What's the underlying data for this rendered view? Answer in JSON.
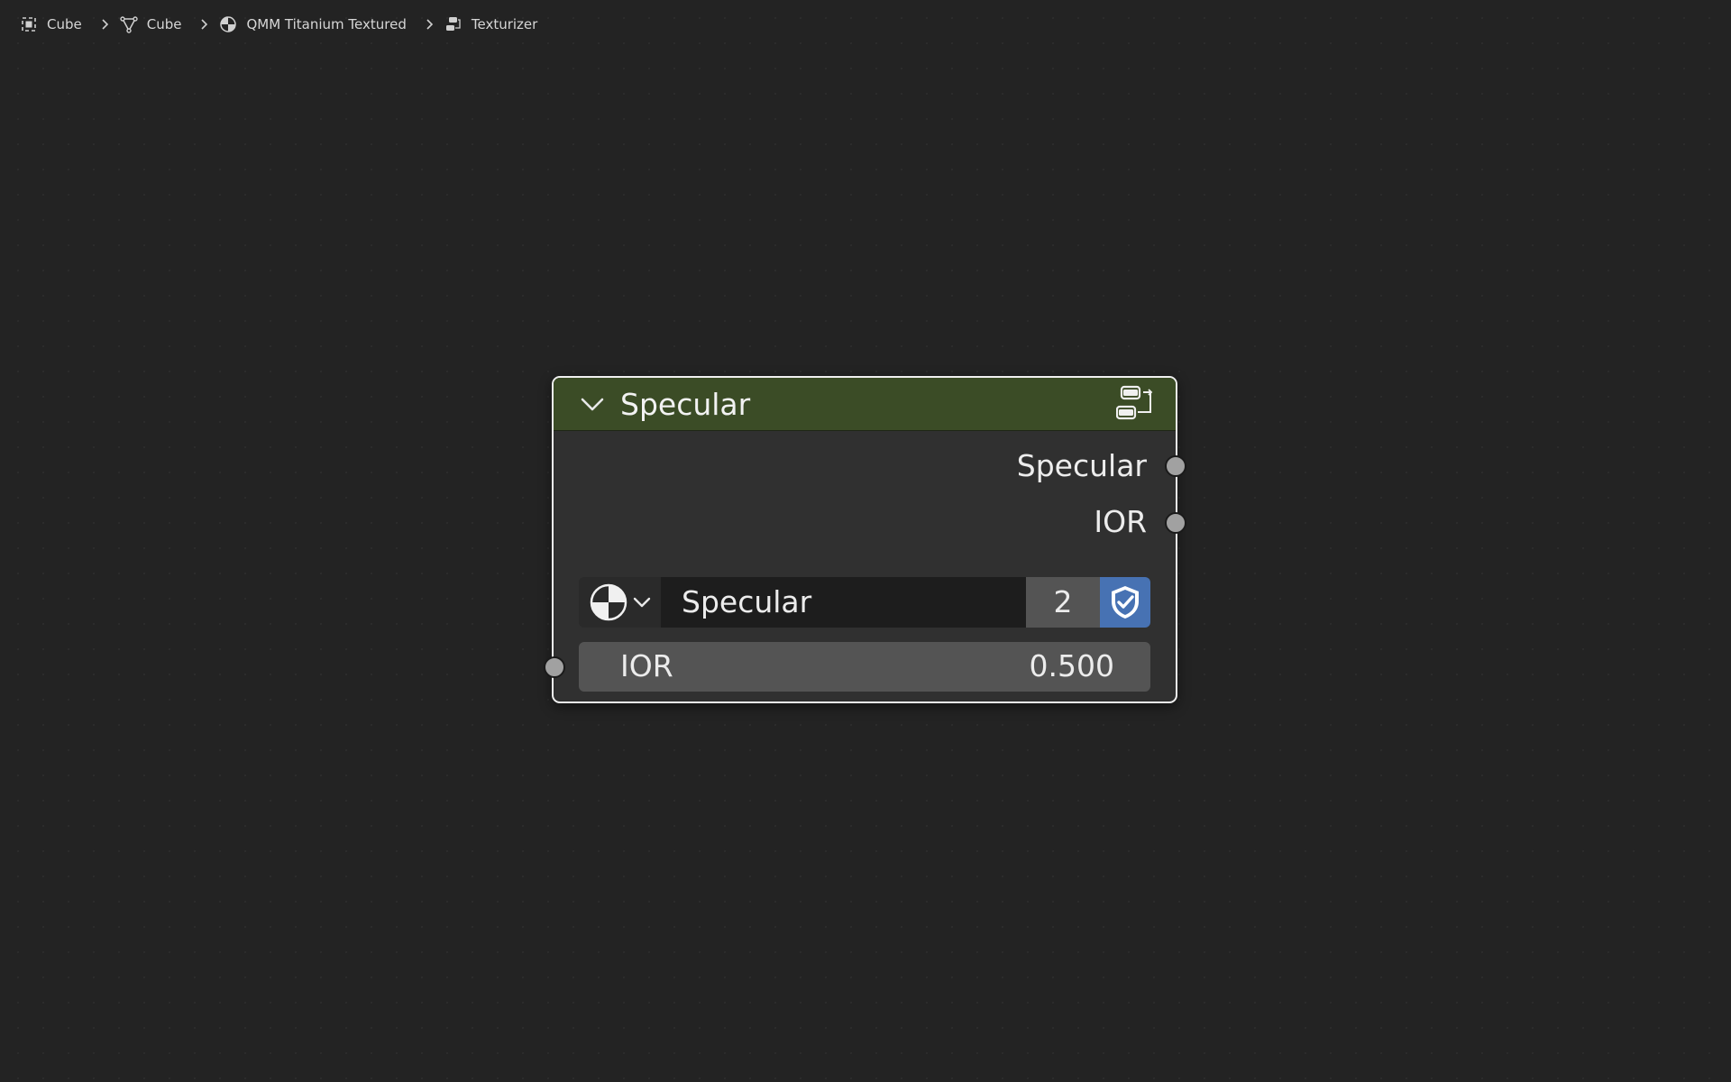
{
  "breadcrumb": {
    "items": [
      {
        "label": "Cube",
        "icon": "object-icon"
      },
      {
        "label": "Cube",
        "icon": "mesh-data-icon"
      },
      {
        "label": "QMM Titanium Textured",
        "icon": "material-icon"
      },
      {
        "label": "Texturizer",
        "icon": "node-tree-icon"
      }
    ]
  },
  "node": {
    "title": "Specular",
    "header_color": "#3b4c26",
    "outputs": [
      {
        "label": "Specular"
      },
      {
        "label": "IOR"
      }
    ],
    "datablock": {
      "name": "Specular",
      "users": "2"
    },
    "input": {
      "label": "IOR",
      "value": "0.500"
    }
  },
  "colors": {
    "background": "#232323",
    "node_body": "#303030",
    "socket": "#a1a1a1",
    "fake_user_active": "#4772b3"
  }
}
